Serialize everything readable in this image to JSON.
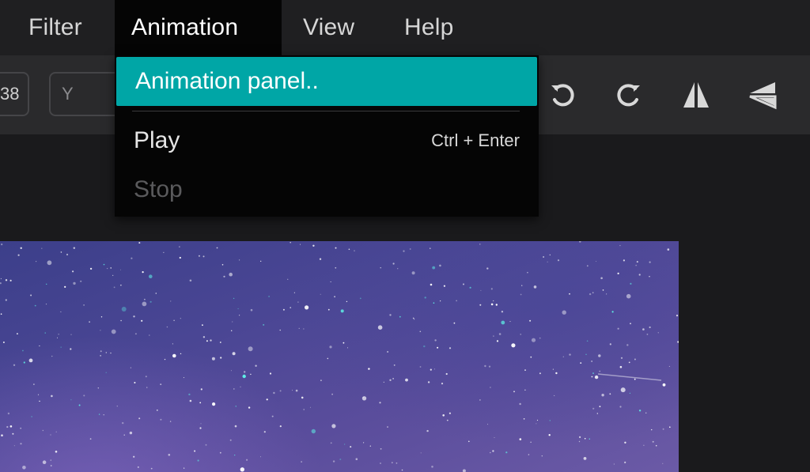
{
  "menubar": {
    "items": [
      {
        "label": "Filter"
      },
      {
        "label": "Animation"
      },
      {
        "label": "View"
      },
      {
        "label": "Help"
      }
    ]
  },
  "toolbar": {
    "field_a_value": "38",
    "field_y_label": "Y",
    "icons": [
      "undo-icon",
      "redo-icon",
      "flip-horizontal-icon",
      "flip-vertical-icon"
    ]
  },
  "animation_menu": {
    "items": [
      {
        "label": "Animation panel..",
        "shortcut": "",
        "state": "highlighted"
      },
      {
        "label": "Play",
        "shortcut": "Ctrl + Enter",
        "state": "enabled"
      },
      {
        "label": "Stop",
        "shortcut": "",
        "state": "disabled"
      }
    ]
  },
  "colors": {
    "highlight": "#00a6a6",
    "menu_bg": "#050505",
    "toolbar_bg": "#2a2a2c",
    "app_bg": "#1f1f21"
  },
  "canvas": {
    "description_icon": "starry-sky-image"
  }
}
